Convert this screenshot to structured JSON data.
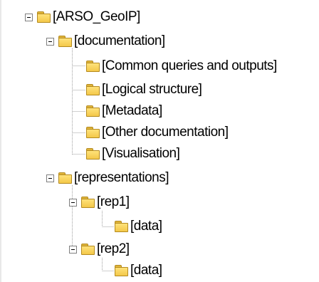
{
  "tree": {
    "root": {
      "label": "[ARSO_GeoIP]",
      "icon": "folder-icon",
      "expanded": true,
      "children": {
        "documentation": {
          "label": "[documentation]",
          "icon": "folder-icon",
          "expanded": true,
          "items": [
            {
              "label": "[Common queries and outputs]",
              "icon": "folder-icon"
            },
            {
              "label": "[Logical structure]",
              "icon": "folder-icon"
            },
            {
              "label": "[Metadata]",
              "icon": "folder-icon"
            },
            {
              "label": "[Other documentation]",
              "icon": "folder-icon"
            },
            {
              "label": "[Visualisation]",
              "icon": "folder-icon"
            }
          ]
        },
        "representations": {
          "label": "[representations]",
          "icon": "folder-icon",
          "expanded": true,
          "reps": [
            {
              "label": "[rep1]",
              "icon": "folder-icon",
              "expanded": true,
              "child": {
                "label": "[data]",
                "icon": "folder-icon"
              }
            },
            {
              "label": "[rep2]",
              "icon": "folder-icon",
              "expanded": true,
              "child": {
                "label": "[data]",
                "icon": "folder-icon"
              }
            }
          ]
        }
      }
    }
  },
  "colors": {
    "folder_fill": "#f4c84a",
    "folder_border": "#b48a1f",
    "connector": "#a0a0a0",
    "toggle_border": "#7f7f7f"
  }
}
